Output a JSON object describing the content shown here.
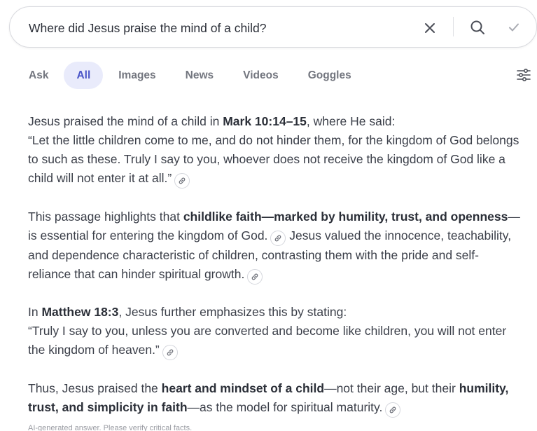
{
  "search": {
    "query": "Where did Jesus praise the mind of a child?"
  },
  "tabs": [
    {
      "label": "Ask",
      "active": false
    },
    {
      "label": "All",
      "active": true
    },
    {
      "label": "Images",
      "active": false
    },
    {
      "label": "News",
      "active": false
    },
    {
      "label": "Videos",
      "active": false
    },
    {
      "label": "Goggles",
      "active": false
    }
  ],
  "answer": {
    "p1": {
      "t1": "Jesus praised the mind of a child in ",
      "b1": "Mark 10:14–15",
      "t2": ", where He said:",
      "quote": "“Let the little children come to me, and do not hinder them, for the kingdom of God belongs to such as these. Truly I say to you, whoever does not receive the kingdom of God like a child will not enter it at all.”"
    },
    "p2": {
      "t1": "This passage highlights that ",
      "b1": "childlike faith—marked by humility, trust, and openness",
      "t2": "—is essential for entering the kingdom of God.",
      "t3": " Jesus valued the innocence, teachability, and dependence characteristic of children, contrasting them with the pride and self-reliance that can hinder spiritual growth."
    },
    "p3": {
      "t1": "In ",
      "b1": "Matthew 18:3",
      "t2": ", Jesus further emphasizes this by stating:",
      "quote": "“Truly I say to you, unless you are converted and become like children, you will not enter the kingdom of heaven.”"
    },
    "p4": {
      "t1": "Thus, Jesus praised the ",
      "b1": "heart and mindset of a child",
      "t2": "—not their age, but their ",
      "b2": "humility, trust, and simplicity in faith",
      "t3": "—as the model for spiritual maturity."
    }
  },
  "disclaimer": "AI-generated answer. Please verify critical facts.",
  "icons": {
    "clear": "close-icon",
    "search": "search-icon",
    "submit": "check-icon",
    "filter": "sliders-icon",
    "citation": "link-icon"
  },
  "colors": {
    "accent": "#4a55c8",
    "active_tab_bg": "#e9ebfb"
  }
}
